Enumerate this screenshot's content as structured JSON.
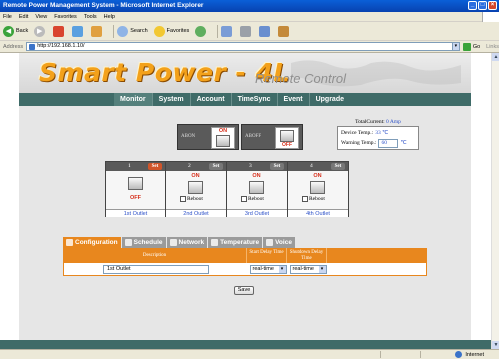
{
  "window": {
    "title": "Remote Power Management System - Microsoft Internet Explorer",
    "controls": [
      "_",
      "□",
      "×"
    ]
  },
  "menu": [
    "File",
    "Edit",
    "View",
    "Favorites",
    "Tools",
    "Help"
  ],
  "toolbar": {
    "back": "Back",
    "search": "Search",
    "favorites": "Favorites"
  },
  "address": {
    "label": "Address",
    "url": "http://192.168.1.10/",
    "go": "Go",
    "links": "Links"
  },
  "header": {
    "logo": "Smart Power - 4L",
    "subtitle": "Remote Control"
  },
  "nav": [
    "Monitor",
    "System",
    "Account",
    "TimeSync",
    "Event",
    "Upgrade"
  ],
  "ab": {
    "a_label": "ABON",
    "a_state": "ON",
    "b_label": "ABOFF",
    "b_state": "OFF"
  },
  "current": {
    "total_label": "TotalCurrent:",
    "total_value": "0 Amp",
    "device_temp_label": "Device Temp.:",
    "device_temp_value": "33 ℃",
    "warning_temp_label": "Warning Temp.:",
    "warning_temp_value": "60",
    "warning_temp_unit": "℃"
  },
  "outlets": [
    {
      "num": "1",
      "set": "Set",
      "state": "OFF",
      "reboot": "",
      "name": "1st Outlet"
    },
    {
      "num": "2",
      "set": "Set",
      "state": "ON",
      "reboot": "Reboot",
      "name": "2nd Outlet"
    },
    {
      "num": "3",
      "set": "Set",
      "state": "ON",
      "reboot": "Reboot",
      "name": "3rd Outlet"
    },
    {
      "num": "4",
      "set": "Set",
      "state": "ON",
      "reboot": "Reboot",
      "name": "4th Outlet"
    }
  ],
  "tabs": [
    "Configuration",
    "Schedule",
    "Network",
    "Temperature",
    "Voice"
  ],
  "config": {
    "col_description": "Description",
    "col_start": "Start Delay Time",
    "col_shutdown": "Shutdown Delay Time",
    "description_value": "1st Outlet",
    "start_value": "real-time",
    "shutdown_value": "real-time"
  },
  "save_label": "Save",
  "status": {
    "zone": "Internet"
  },
  "colors": {
    "nav_bg": "#3f6b68",
    "accent_orange": "#e8871e",
    "logo_gold": "#f3a11b",
    "link_blue": "#2d51c9"
  }
}
